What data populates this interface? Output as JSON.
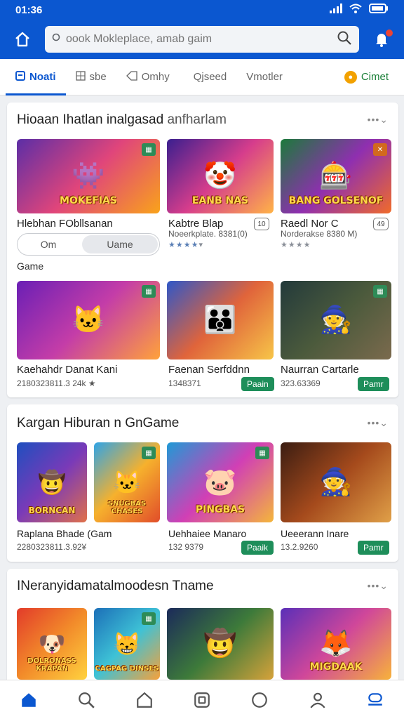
{
  "status": {
    "time": "01:36"
  },
  "search": {
    "placeholder": "oook Mokleplace, amab gaim"
  },
  "tabs": [
    {
      "label": "Noati",
      "active": true,
      "icon": "home-tab-icon"
    },
    {
      "label": "sbe",
      "icon": "grid-icon"
    },
    {
      "label": "Omhy",
      "icon": "tag-icon"
    },
    {
      "label": "Qjseed",
      "icon": "chat-icon"
    },
    {
      "label": "Vmotler",
      "icon": "slash-icon"
    },
    {
      "label": "Cimet",
      "icon": "coin-icon"
    }
  ],
  "section1": {
    "title": "Hioaan Ihatlan inalgasad",
    "subtitle": "anfharlam",
    "more": "•••⌄",
    "segment": {
      "option_a": "Om",
      "option_b": "Uame"
    },
    "category": "Game",
    "games": [
      {
        "title": "Hlebhan FObllsanan",
        "thumb_text": "MOKEFIAS"
      },
      {
        "title": "Kabtre Blap",
        "meta": "Noeerkplate. 8381(0)",
        "rating_badge": "10",
        "thumb_text": "EANB NAS"
      },
      {
        "title": "Raedl Nor C",
        "meta": "Norderakse 8380 M)",
        "rating_badge": "49",
        "thumb_text": "BANG GOLSENOF"
      },
      {
        "title": "Kaehahdr Danat Kani",
        "meta": "2180323811.3 24k ★",
        "thumb_text": ""
      },
      {
        "title": "Faenan Serfddnn",
        "meta": "1348371",
        "play": "Paain",
        "thumb_text": ""
      },
      {
        "title": "Naurran Cartarle",
        "meta": "323.63369",
        "play": "Pamr",
        "thumb_text": ""
      }
    ]
  },
  "section2": {
    "title": "Kargan Hiburan n GnGame",
    "more": "•••⌄",
    "games": [
      {
        "title": "Raplana Bhade (Gam",
        "meta": "2280323811.3.92¥",
        "thumb_text": "BORNCAN"
      },
      {
        "title": "",
        "meta": "",
        "thumb_text": "SNUGBAS CHASES"
      },
      {
        "title": "Uehhaiee Manaro",
        "meta": "132 9379",
        "play": "Paaik",
        "thumb_text": "PINGBAS"
      },
      {
        "title": "Ueeerann Inare",
        "meta": "13.2.9260",
        "play": "Pamr",
        "thumb_text": ""
      }
    ]
  },
  "section3": {
    "title": "INeranyidamatalmoodesn Tname",
    "more": "•••⌄",
    "games": [
      {
        "thumb_text": "DOLRONASS KRAPAN"
      },
      {
        "thumb_text": "CAGPAG DINSES"
      },
      {
        "thumb_text": ""
      },
      {
        "thumb_text": "MIGDAAK"
      }
    ]
  },
  "colors": {
    "brand": "#0b57d0",
    "play": "#1e8e5a",
    "coin": "#f2a100"
  }
}
